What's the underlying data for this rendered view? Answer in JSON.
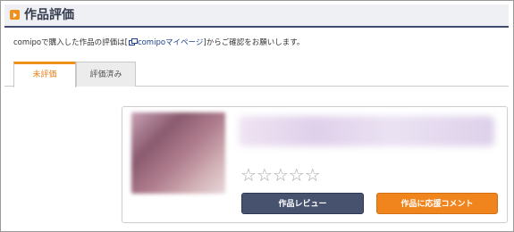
{
  "header": {
    "title": "作品評価",
    "icon": "play-icon",
    "accent_color": "#f0911e",
    "underline_color": "#3f4e72"
  },
  "info": {
    "text_before": "comipoで購入した作品の評価は[",
    "link_label": "comipoマイページ",
    "text_after": "]からご確認をお願いします。",
    "link_icon": "external-window-icon"
  },
  "tabs": [
    {
      "label": "未評価",
      "active": true
    },
    {
      "label": "評価済み",
      "active": false
    }
  ],
  "item": {
    "rating": {
      "value": 0,
      "max": 5,
      "stars": "☆☆☆☆☆"
    },
    "review_button_label": "作品レビュー",
    "comment_button_label": "作品に応援コメント",
    "review_button_color": "#47526f",
    "comment_button_color": "#f0851e"
  }
}
